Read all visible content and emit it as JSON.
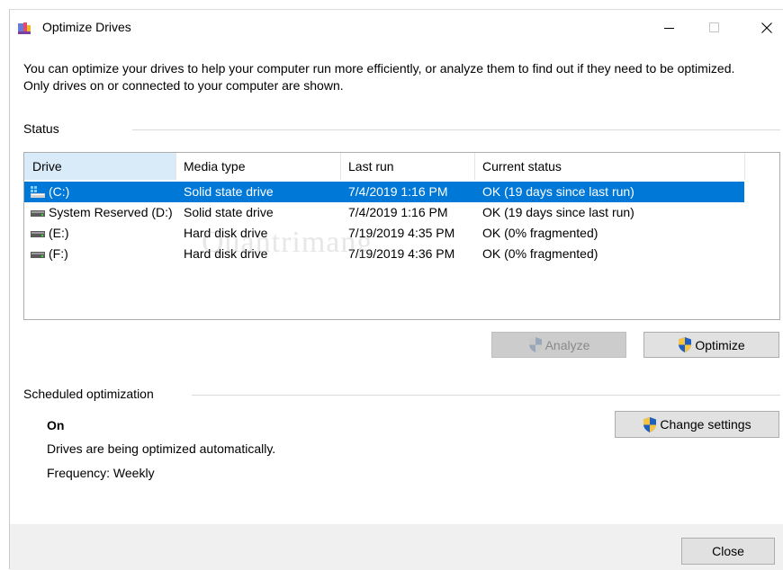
{
  "window": {
    "title": "Optimize Drives",
    "description": "You can optimize your drives to help your computer run more efficiently, or analyze them to find out if they need to be optimized. Only drives on or connected to your computer are shown."
  },
  "status": {
    "label": "Status",
    "columns": [
      "Drive",
      "Media type",
      "Last run",
      "Current status"
    ],
    "rows": [
      {
        "drive": "(C:)",
        "media": "Solid state drive",
        "last_run": "7/4/2019 1:16 PM",
        "status": "OK (19 days since last run)",
        "selected": true,
        "icon": "ssd-system-icon"
      },
      {
        "drive": "System Reserved (D:)",
        "media": "Solid state drive",
        "last_run": "7/4/2019 1:16 PM",
        "status": "OK (19 days since last run)",
        "selected": false,
        "icon": "drive-icon"
      },
      {
        "drive": "(E:)",
        "media": "Hard disk drive",
        "last_run": "7/19/2019 4:35 PM",
        "status": "OK (0% fragmented)",
        "selected": false,
        "icon": "drive-icon"
      },
      {
        "drive": "(F:)",
        "media": "Hard disk drive",
        "last_run": "7/19/2019 4:36 PM",
        "status": "OK (0% fragmented)",
        "selected": false,
        "icon": "drive-icon"
      }
    ]
  },
  "actions": {
    "analyze_label": "Analyze",
    "optimize_label": "Optimize"
  },
  "scheduled": {
    "label": "Scheduled optimization",
    "state": "On",
    "message": "Drives are being optimized automatically.",
    "frequency": "Frequency: Weekly",
    "change_settings_label": "Change settings"
  },
  "footer": {
    "close_label": "Close"
  },
  "watermark": "Quantrimang",
  "colors": {
    "selection": "#0078d7",
    "header_selected": "#d9ebf9",
    "button_face": "#e1e1e1"
  }
}
